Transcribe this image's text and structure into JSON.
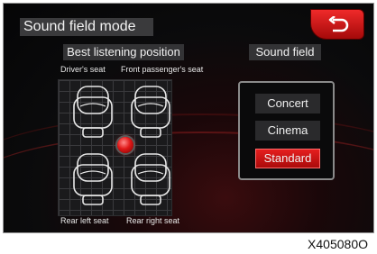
{
  "header": {
    "title": "Sound field mode",
    "back_icon": "return-arrow-icon"
  },
  "listening": {
    "heading": "Best listening position",
    "seats": {
      "driver": "Driver's seat",
      "front_passenger": "Front passenger's seat",
      "rear_left": "Rear left seat",
      "rear_right": "Rear right seat"
    }
  },
  "sound_field": {
    "heading": "Sound field",
    "options": [
      "Concert",
      "Cinema",
      "Standard"
    ],
    "selected": "Standard"
  },
  "figure_code": "X405080O",
  "colors": {
    "accent": "#d41414",
    "background": "#0b0b0c"
  }
}
